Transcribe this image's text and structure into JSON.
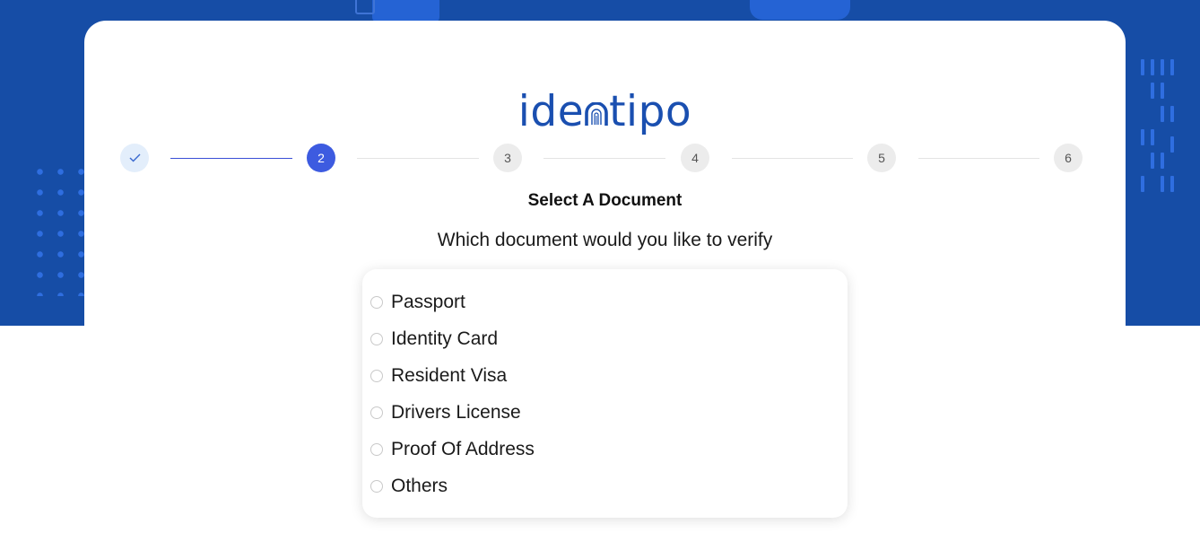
{
  "brand": {
    "logo_text_before": "ide",
    "logo_text_after": "tipo",
    "logo_icon": "fingerprint-icon",
    "color": "#1a4fb0"
  },
  "stepper": {
    "steps": [
      {
        "label": "",
        "icon": "check-icon",
        "state": "done"
      },
      {
        "label": "2",
        "state": "active"
      },
      {
        "label": "3",
        "state": "pending"
      },
      {
        "label": "4",
        "state": "pending"
      },
      {
        "label": "5",
        "state": "pending"
      },
      {
        "label": "6",
        "state": "pending"
      }
    ]
  },
  "page": {
    "title": "Select A Document",
    "subtitle": "Which document would you like to verify"
  },
  "documents": {
    "options": [
      {
        "label": "Passport",
        "selected": false
      },
      {
        "label": "Identity Card",
        "selected": false
      },
      {
        "label": "Resident Visa",
        "selected": false
      },
      {
        "label": "Drivers License",
        "selected": false
      },
      {
        "label": "Proof Of Address",
        "selected": false
      },
      {
        "label": "Others",
        "selected": false
      }
    ]
  },
  "colors": {
    "background": "#164da6",
    "accent": "#3d5be0",
    "done_step": "#e3eefb"
  }
}
